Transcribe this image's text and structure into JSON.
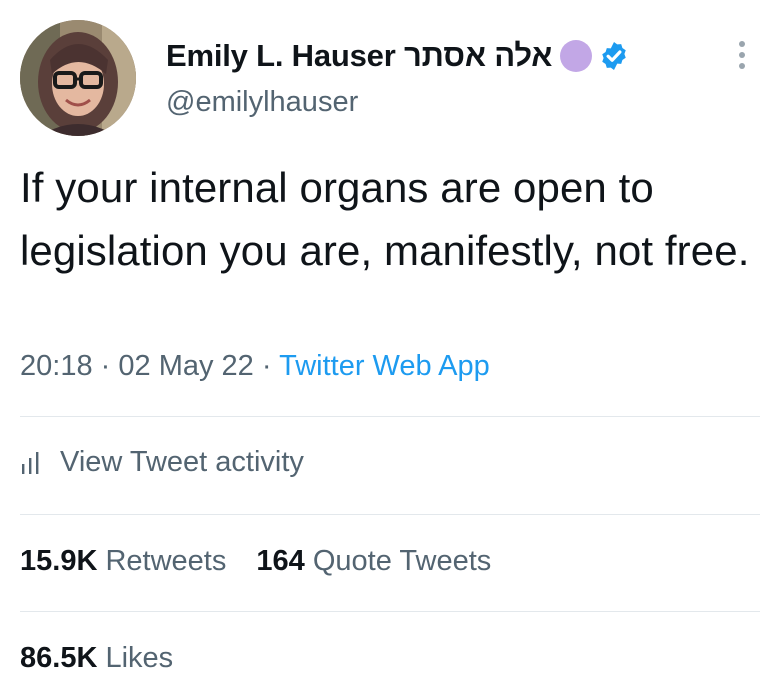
{
  "author": {
    "display_name": "Emily L. Hauser אלה אסתר",
    "handle": "@emilylhauser",
    "verified": true,
    "accent_dot_color": "#c2a7e6",
    "verified_color": "#1d9bf0"
  },
  "tweet": {
    "text": "If your internal organs are open to legislation you are, manifestly, not free.",
    "time": "20:18",
    "separator": "·",
    "date": "02 May 22",
    "source": "Twitter Web App"
  },
  "activity": {
    "icon": "bar-chart-icon",
    "label": "View Tweet activity"
  },
  "stats": {
    "retweets_count": "15.9K",
    "retweets_label": "Retweets",
    "quotes_count": "164",
    "quotes_label": "Quote Tweets",
    "likes_count": "86.5K",
    "likes_label": "Likes"
  },
  "icons": {
    "more": "more-options-icon",
    "verified": "verified-badge-icon"
  }
}
